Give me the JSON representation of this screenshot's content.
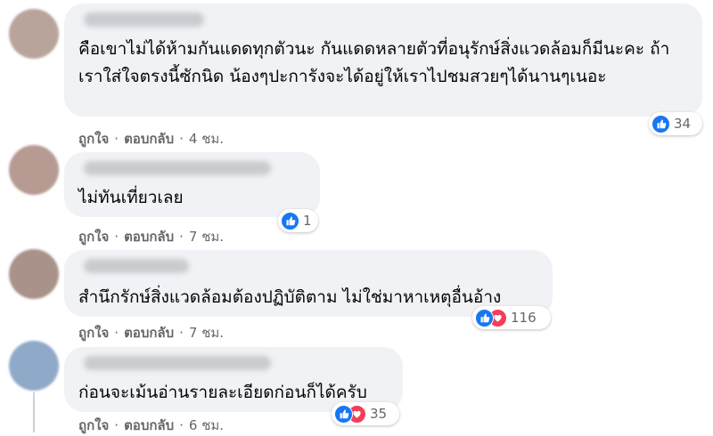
{
  "comments": [
    {
      "text": "คือเขาไม่ได้ห้ามกันแดดทุกตัวนะ กันแดดหลายตัวที่อนุรักษ์สิ่งแวดล้อมก็มีนะคะ ถ้าเราใส่ใจตรงนี้ซักนิด น้องๆปะการังจะได้อยู่ให้เราไปชมสวยๆได้นานๆเนอะ",
      "reaction_count": "34",
      "reactions": [
        "like"
      ],
      "like_label": "ถูกใจ",
      "reply_label": "ตอบกลับ",
      "time": "4 ชม.",
      "avatar_color": "#b9a49c"
    },
    {
      "text": "ไม่ทันเที่ยวเลย",
      "reaction_count": "1",
      "reactions": [
        "like"
      ],
      "like_label": "ถูกใจ",
      "reply_label": "ตอบกลับ",
      "time": "7 ชม.",
      "avatar_color": "#b79a92"
    },
    {
      "text": "สำนึกรักษ์สิ่งแวดล้อมต้องปฏิบัติตาม ไม่ใช่มาหาเหตุอื่นอ้าง",
      "reaction_count": "116",
      "reactions": [
        "like",
        "love"
      ],
      "like_label": "ถูกใจ",
      "reply_label": "ตอบกลับ",
      "time": "7 ชม.",
      "avatar_color": "#a8928a"
    },
    {
      "text": "ก่อนจะเม้นอ่านรายละเอียดก่อนก็ได้ครับ",
      "reaction_count": "35",
      "reactions": [
        "like",
        "love"
      ],
      "like_label": "ถูกใจ",
      "reply_label": "ตอบกลับ",
      "time": "6 ชม.",
      "avatar_color": "#8fa9c9"
    }
  ],
  "separator": "·",
  "colors": {
    "bubble": "#f0f2f5",
    "like": "#1877f2",
    "love": "#f33e58",
    "meta": "#65676b"
  }
}
